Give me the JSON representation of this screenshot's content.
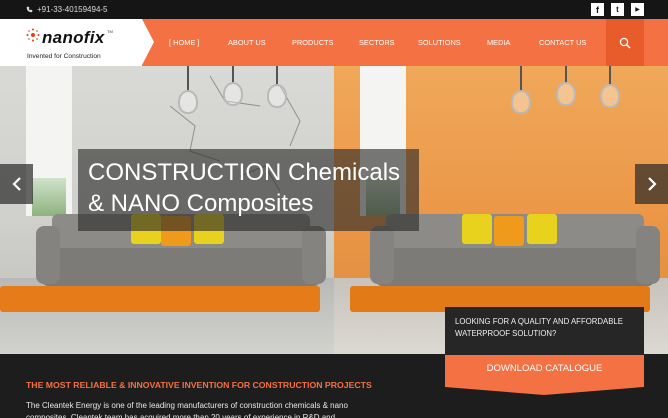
{
  "topbar": {
    "phone": "+91-33-40159494-5",
    "social": [
      "facebook-icon",
      "twitter-icon",
      "youtube-icon"
    ],
    "social_glyphs": [
      "f",
      "t",
      "▶"
    ]
  },
  "brand": {
    "name": "nanofix",
    "tm": "TM",
    "tagline": "Invented for Construction"
  },
  "nav": {
    "home": "[ HOME ]",
    "items": [
      "ABOUT US",
      "PRODUCTS",
      "SECTORS",
      "SOLUTIONS",
      "MEDIA",
      "CONTACT US"
    ]
  },
  "hero": {
    "title_line1": "CONSTRUCTION Chemicals",
    "title_line2": "& NANO Composites"
  },
  "cta": {
    "question": "LOOKING FOR A QUALITY AND AFFORDABLE WATERPROOF SOLUTION?",
    "button": "DOWNLOAD CATALOGUE"
  },
  "intro": {
    "headline": "THE MOST RELIABLE & INNOVATIVE INVENTION FOR CONSTRUCTION PROJECTS",
    "text": "The Cleantek Energy is one of the leading manufacturers of construction chemicals & nano composites. Cleantek team has acquired more than 20 years of experience in R&D and"
  },
  "colors": {
    "accent": "#f37142",
    "dark": "#1d1d1d"
  }
}
